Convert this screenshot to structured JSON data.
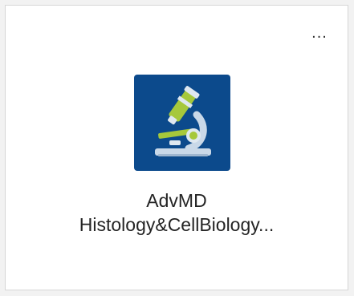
{
  "card": {
    "more_label": "...",
    "icon_name": "microscope-icon",
    "icon_bg_color": "#0c4a8c",
    "title_line1": "AdvMD",
    "title_line2": "Histology&CellBiology..."
  }
}
